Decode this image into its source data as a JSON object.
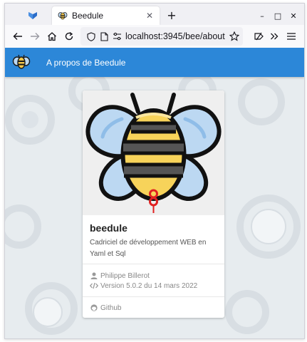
{
  "browser": {
    "tab_title": "Beedule",
    "tab_close": "✕",
    "new_tab": "+",
    "url_host": "localhost:",
    "url_rest": "3945/bee/about",
    "window_controls": {
      "minimize": "–",
      "maximize": "□",
      "close": "✕"
    }
  },
  "app": {
    "title": "A propos de Beedule",
    "brand_color": "#2c87d8"
  },
  "card": {
    "name": "beedule",
    "description": "Cadriciel de développement WEB en Yaml et Sql",
    "author": "Philippe Billerot",
    "version": "Version 5.0.2 du 14 mars 2022",
    "link": "Github"
  },
  "icons": [
    "firefox-view-icon",
    "bee-favicon",
    "back-arrow-icon",
    "forward-arrow-icon",
    "home-icon",
    "reload-icon",
    "shield-icon",
    "page-icon",
    "permissions-icon",
    "bookmark-star-icon",
    "extensions-icon",
    "overflow-icon",
    "menu-icon",
    "user-icon",
    "code-icon",
    "github-icon"
  ]
}
